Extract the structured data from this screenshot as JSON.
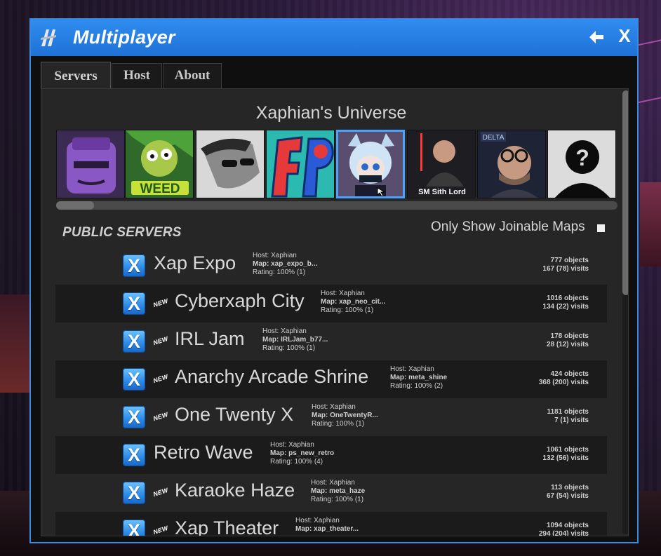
{
  "window": {
    "title": "Multiplayer",
    "back_icon": "arrow-left-icon",
    "close_label": "X",
    "colors": {
      "titlebar": "#2f8cf0",
      "accent": "#4aa3ff",
      "panel": "#262626"
    }
  },
  "tabs": [
    {
      "label": "Servers",
      "active": true
    },
    {
      "label": "Host",
      "active": false
    },
    {
      "label": "About",
      "active": false
    }
  ],
  "universe": {
    "title": "Xaphian's Universe",
    "avatars": [
      {
        "icon": "purple-character-avatar",
        "caption": ""
      },
      {
        "icon": "zombie-weed-avatar",
        "caption": "WEED"
      },
      {
        "icon": "sunglasses-man-avatar",
        "caption": ""
      },
      {
        "icon": "fp-logo-avatar",
        "caption": ""
      },
      {
        "icon": "anime-catgirl-avatar",
        "caption": "",
        "selected": true
      },
      {
        "icon": "sith-lord-avatar",
        "caption": "SM Sith Lord"
      },
      {
        "icon": "glasses-man-avatar",
        "caption": "DELTA"
      },
      {
        "icon": "unknown-silhouette-avatar",
        "caption": "?"
      }
    ]
  },
  "servers_section": {
    "title": "PUBLIC SERVERS",
    "joinable_label": "Only Show Joinable Maps",
    "joinable_checked": false
  },
  "servers": [
    {
      "name": "Xap Expo",
      "is_new": false,
      "host": "Host: Xaphian",
      "map": "Map: xap_expo_b...",
      "rating": "Rating: 100% (1)",
      "objects": "777 objects",
      "visits": "167 (78) visits"
    },
    {
      "name": "Cyberxaph City",
      "is_new": true,
      "host": "Host: Xaphian",
      "map": "Map: xap_neo_cit...",
      "rating": "Rating: 100% (1)",
      "objects": "1016 objects",
      "visits": "134 (22) visits"
    },
    {
      "name": "IRL Jam",
      "is_new": true,
      "host": "Host: Xaphian",
      "map": "Map: IRLJam_b77...",
      "rating": "Rating: 100% (1)",
      "objects": "178 objects",
      "visits": "28 (12) visits"
    },
    {
      "name": "Anarchy Arcade Shrine",
      "is_new": true,
      "host": "Host: Xaphian",
      "map": "Map: meta_shine",
      "rating": "Rating: 100% (2)",
      "objects": "424 objects",
      "visits": "368 (200) visits"
    },
    {
      "name": "One Twenty X",
      "is_new": true,
      "host": "Host: Xaphian",
      "map": "Map: OneTwentyR...",
      "rating": "Rating: 100% (1)",
      "objects": "1181 objects",
      "visits": "7 (1) visits"
    },
    {
      "name": "Retro Wave",
      "is_new": false,
      "host": "Host: Xaphian",
      "map": "Map: ps_new_retro",
      "rating": "Rating: 100% (4)",
      "objects": "1061 objects",
      "visits": "132 (56) visits"
    },
    {
      "name": "Karaoke Haze",
      "is_new": true,
      "host": "Host: Xaphian",
      "map": "Map: meta_haze",
      "rating": "Rating: 100% (1)",
      "objects": "113 objects",
      "visits": "67 (54) visits"
    },
    {
      "name": "Xap Theater",
      "is_new": true,
      "host": "Host: Xaphian",
      "map": "Map: xap_theater...",
      "rating": "",
      "objects": "1094 objects",
      "visits": "294 (204) visits"
    }
  ],
  "new_badge_label": "NEW"
}
